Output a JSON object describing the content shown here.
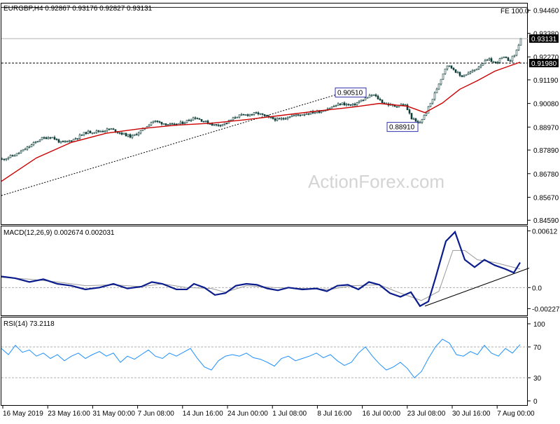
{
  "header": {
    "symbol_ohlc": "EURGBP,H4  0.92867 0.93176 0.92827 0.93131",
    "fe_label": "FE 100.0",
    "watermark": "ActionForex.com"
  },
  "colors": {
    "candles": "#0d3d38",
    "ma": "#cc0000",
    "macd": "#0b1c8c",
    "signal": "#999999",
    "rsi": "#1e90ff",
    "grid": "#b0b0b0"
  },
  "chart_data": [
    {
      "type": "candlestick",
      "panel": "price",
      "ylim": [
        0.844,
        0.9478
      ],
      "yticks": [
        "0.94460",
        "0.93380",
        "0.92270",
        "0.91190",
        "0.90080",
        "0.88970",
        "0.87890",
        "0.86780",
        "0.85670",
        "0.84590"
      ],
      "price_tags": [
        "0.93131",
        "0.91980"
      ],
      "annotations": [
        "0.90510",
        "0.88910"
      ],
      "close_path": [
        {
          "x": 0,
          "y": 0.8745
        },
        {
          "x": 20,
          "y": 0.8768
        },
        {
          "x": 40,
          "y": 0.8808
        },
        {
          "x": 55,
          "y": 0.8842
        },
        {
          "x": 70,
          "y": 0.8852
        },
        {
          "x": 85,
          "y": 0.8822
        },
        {
          "x": 100,
          "y": 0.8835
        },
        {
          "x": 120,
          "y": 0.8872
        },
        {
          "x": 140,
          "y": 0.8878
        },
        {
          "x": 155,
          "y": 0.8888
        },
        {
          "x": 170,
          "y": 0.8868
        },
        {
          "x": 185,
          "y": 0.8851
        },
        {
          "x": 200,
          "y": 0.8882
        },
        {
          "x": 215,
          "y": 0.8926
        },
        {
          "x": 230,
          "y": 0.8915
        },
        {
          "x": 245,
          "y": 0.8905
        },
        {
          "x": 260,
          "y": 0.892
        },
        {
          "x": 275,
          "y": 0.8944
        },
        {
          "x": 290,
          "y": 0.8922
        },
        {
          "x": 305,
          "y": 0.8905
        },
        {
          "x": 320,
          "y": 0.8915
        },
        {
          "x": 335,
          "y": 0.8948
        },
        {
          "x": 350,
          "y": 0.8955
        },
        {
          "x": 365,
          "y": 0.8962
        },
        {
          "x": 380,
          "y": 0.8942
        },
        {
          "x": 395,
          "y": 0.893
        },
        {
          "x": 410,
          "y": 0.8948
        },
        {
          "x": 425,
          "y": 0.8955
        },
        {
          "x": 440,
          "y": 0.8965
        },
        {
          "x": 455,
          "y": 0.8972
        },
        {
          "x": 470,
          "y": 0.899
        },
        {
          "x": 485,
          "y": 0.9008
        },
        {
          "x": 500,
          "y": 0.8998
        },
        {
          "x": 515,
          "y": 0.9025
        },
        {
          "x": 530,
          "y": 0.905
        },
        {
          "x": 545,
          "y": 0.901
        },
        {
          "x": 560,
          "y": 0.8995
        },
        {
          "x": 575,
          "y": 0.9005
        },
        {
          "x": 585,
          "y": 0.894
        },
        {
          "x": 595,
          "y": 0.891
        },
        {
          "x": 605,
          "y": 0.896
        },
        {
          "x": 615,
          "y": 0.903
        },
        {
          "x": 625,
          "y": 0.911
        },
        {
          "x": 635,
          "y": 0.919
        },
        {
          "x": 645,
          "y": 0.917
        },
        {
          "x": 655,
          "y": 0.9135
        },
        {
          "x": 665,
          "y": 0.9148
        },
        {
          "x": 675,
          "y": 0.9165
        },
        {
          "x": 685,
          "y": 0.9195
        },
        {
          "x": 695,
          "y": 0.9215
        },
        {
          "x": 705,
          "y": 0.9198
        },
        {
          "x": 715,
          "y": 0.9225
        },
        {
          "x": 725,
          "y": 0.921
        },
        {
          "x": 733,
          "y": 0.924
        },
        {
          "x": 741,
          "y": 0.9313
        }
      ],
      "ma_path": [
        {
          "x": 0,
          "y": 0.8642
        },
        {
          "x": 50,
          "y": 0.8752
        },
        {
          "x": 100,
          "y": 0.8825
        },
        {
          "x": 150,
          "y": 0.8868
        },
        {
          "x": 200,
          "y": 0.889
        },
        {
          "x": 250,
          "y": 0.8906
        },
        {
          "x": 300,
          "y": 0.8915
        },
        {
          "x": 350,
          "y": 0.8932
        },
        {
          "x": 400,
          "y": 0.8952
        },
        {
          "x": 450,
          "y": 0.8972
        },
        {
          "x": 500,
          "y": 0.899
        },
        {
          "x": 540,
          "y": 0.9008
        },
        {
          "x": 580,
          "y": 0.8995
        },
        {
          "x": 605,
          "y": 0.8965
        },
        {
          "x": 630,
          "y": 0.901
        },
        {
          "x": 655,
          "y": 0.9075
        },
        {
          "x": 680,
          "y": 0.9115
        },
        {
          "x": 705,
          "y": 0.916
        },
        {
          "x": 741,
          "y": 0.9202
        }
      ],
      "trendline_dotted": [
        {
          "x": 0,
          "y": 0.8575
        },
        {
          "x": 480,
          "y": 0.9051
        }
      ],
      "dashed_level": 0.9198,
      "solid_level": 0.9313,
      "fe_level": 0.946
    },
    {
      "type": "line",
      "panel": "macd",
      "label": "MACD(12,26,9) 0.002674 0.002031",
      "ylim": [
        -0.003,
        0.0066
      ],
      "yticks": [
        "0.00612",
        "0.0",
        "-0.002273"
      ],
      "macd": [
        {
          "x": 0,
          "y": 0.0012
        },
        {
          "x": 20,
          "y": 0.001
        },
        {
          "x": 40,
          "y": 0.0006
        },
        {
          "x": 60,
          "y": 0.0009
        },
        {
          "x": 80,
          "y": 0.0004
        },
        {
          "x": 100,
          "y": 0.0002
        },
        {
          "x": 120,
          "y": -0.0002
        },
        {
          "x": 140,
          "y": 0.0
        },
        {
          "x": 160,
          "y": 0.0004
        },
        {
          "x": 180,
          "y": -0.0001
        },
        {
          "x": 200,
          "y": 0.0001
        },
        {
          "x": 215,
          "y": 0.0006
        },
        {
          "x": 230,
          "y": 0.0004
        },
        {
          "x": 250,
          "y": -0.0002
        },
        {
          "x": 265,
          "y": -0.0002
        },
        {
          "x": 275,
          "y": 0.0004
        },
        {
          "x": 290,
          "y": 0.0
        },
        {
          "x": 305,
          "y": -0.0008
        },
        {
          "x": 320,
          "y": -0.0006
        },
        {
          "x": 335,
          "y": 0.0002
        },
        {
          "x": 350,
          "y": 0.0004
        },
        {
          "x": 365,
          "y": 0.0003
        },
        {
          "x": 380,
          "y": -0.0001
        },
        {
          "x": 395,
          "y": -0.0003
        },
        {
          "x": 410,
          "y": 0.0
        },
        {
          "x": 430,
          "y": -0.0002
        },
        {
          "x": 450,
          "y": -0.0001
        },
        {
          "x": 465,
          "y": -0.0004
        },
        {
          "x": 480,
          "y": 0.0002
        },
        {
          "x": 495,
          "y": 0.0003
        },
        {
          "x": 510,
          "y": -0.0002
        },
        {
          "x": 525,
          "y": 0.0006
        },
        {
          "x": 540,
          "y": 0.0003
        },
        {
          "x": 555,
          "y": -0.0006
        },
        {
          "x": 570,
          "y": -0.001
        },
        {
          "x": 585,
          "y": -0.0005
        },
        {
          "x": 598,
          "y": -0.002
        },
        {
          "x": 610,
          "y": -0.0015
        },
        {
          "x": 620,
          "y": 0.001
        },
        {
          "x": 635,
          "y": 0.005
        },
        {
          "x": 648,
          "y": 0.006
        },
        {
          "x": 662,
          "y": 0.003
        },
        {
          "x": 676,
          "y": 0.0022
        },
        {
          "x": 690,
          "y": 0.003
        },
        {
          "x": 705,
          "y": 0.0024
        },
        {
          "x": 720,
          "y": 0.002
        },
        {
          "x": 732,
          "y": 0.0016
        },
        {
          "x": 741,
          "y": 0.0027
        }
      ],
      "signal": [
        {
          "x": 0,
          "y": 0.0011
        },
        {
          "x": 40,
          "y": 0.0009
        },
        {
          "x": 80,
          "y": 0.0006
        },
        {
          "x": 120,
          "y": 0.0002
        },
        {
          "x": 160,
          "y": 0.0003
        },
        {
          "x": 200,
          "y": 0.0001
        },
        {
          "x": 230,
          "y": 0.0004
        },
        {
          "x": 265,
          "y": 0.0
        },
        {
          "x": 300,
          "y": -0.0001
        },
        {
          "x": 320,
          "y": -0.0005
        },
        {
          "x": 350,
          "y": 0.0002
        },
        {
          "x": 390,
          "y": 0.0
        },
        {
          "x": 430,
          "y": -0.0001
        },
        {
          "x": 470,
          "y": -0.0002
        },
        {
          "x": 500,
          "y": 0.0002
        },
        {
          "x": 540,
          "y": 0.0003
        },
        {
          "x": 570,
          "y": -0.0006
        },
        {
          "x": 600,
          "y": -0.0014
        },
        {
          "x": 625,
          "y": -0.0004
        },
        {
          "x": 645,
          "y": 0.004
        },
        {
          "x": 662,
          "y": 0.004
        },
        {
          "x": 680,
          "y": 0.003
        },
        {
          "x": 705,
          "y": 0.0027
        },
        {
          "x": 741,
          "y": 0.002
        }
      ],
      "trendline": [
        {
          "x": 605,
          "y": -0.002
        },
        {
          "x": 754,
          "y": 0.0021
        }
      ],
      "zero_line": 0.0
    },
    {
      "type": "line",
      "panel": "rsi",
      "label": "RSI(14) 73.2118",
      "ylim": [
        0,
        100
      ],
      "yticks": [
        "100",
        "70",
        "30",
        "0"
      ],
      "levels": [
        70,
        30
      ],
      "values": [
        {
          "x": 0,
          "y": 68
        },
        {
          "x": 10,
          "y": 60
        },
        {
          "x": 20,
          "y": 72
        },
        {
          "x": 30,
          "y": 63
        },
        {
          "x": 40,
          "y": 66
        },
        {
          "x": 50,
          "y": 58
        },
        {
          "x": 60,
          "y": 62
        },
        {
          "x": 70,
          "y": 55
        },
        {
          "x": 80,
          "y": 60
        },
        {
          "x": 90,
          "y": 52
        },
        {
          "x": 100,
          "y": 58
        },
        {
          "x": 110,
          "y": 62
        },
        {
          "x": 120,
          "y": 55
        },
        {
          "x": 130,
          "y": 60
        },
        {
          "x": 140,
          "y": 64
        },
        {
          "x": 150,
          "y": 58
        },
        {
          "x": 160,
          "y": 62
        },
        {
          "x": 170,
          "y": 50
        },
        {
          "x": 180,
          "y": 58
        },
        {
          "x": 190,
          "y": 54
        },
        {
          "x": 200,
          "y": 60
        },
        {
          "x": 210,
          "y": 66
        },
        {
          "x": 220,
          "y": 58
        },
        {
          "x": 230,
          "y": 55
        },
        {
          "x": 240,
          "y": 62
        },
        {
          "x": 250,
          "y": 58
        },
        {
          "x": 260,
          "y": 63
        },
        {
          "x": 270,
          "y": 68
        },
        {
          "x": 280,
          "y": 55
        },
        {
          "x": 290,
          "y": 44
        },
        {
          "x": 300,
          "y": 40
        },
        {
          "x": 310,
          "y": 52
        },
        {
          "x": 320,
          "y": 58
        },
        {
          "x": 330,
          "y": 60
        },
        {
          "x": 340,
          "y": 58
        },
        {
          "x": 350,
          "y": 62
        },
        {
          "x": 360,
          "y": 56
        },
        {
          "x": 370,
          "y": 54
        },
        {
          "x": 380,
          "y": 50
        },
        {
          "x": 390,
          "y": 45
        },
        {
          "x": 400,
          "y": 55
        },
        {
          "x": 410,
          "y": 58
        },
        {
          "x": 420,
          "y": 52
        },
        {
          "x": 430,
          "y": 55
        },
        {
          "x": 440,
          "y": 58
        },
        {
          "x": 450,
          "y": 62
        },
        {
          "x": 460,
          "y": 56
        },
        {
          "x": 470,
          "y": 60
        },
        {
          "x": 480,
          "y": 52
        },
        {
          "x": 490,
          "y": 46
        },
        {
          "x": 500,
          "y": 50
        },
        {
          "x": 510,
          "y": 62
        },
        {
          "x": 520,
          "y": 70
        },
        {
          "x": 530,
          "y": 58
        },
        {
          "x": 540,
          "y": 48
        },
        {
          "x": 550,
          "y": 40
        },
        {
          "x": 560,
          "y": 44
        },
        {
          "x": 570,
          "y": 50
        },
        {
          "x": 580,
          "y": 42
        },
        {
          "x": 590,
          "y": 30
        },
        {
          "x": 600,
          "y": 38
        },
        {
          "x": 610,
          "y": 55
        },
        {
          "x": 620,
          "y": 70
        },
        {
          "x": 630,
          "y": 80
        },
        {
          "x": 640,
          "y": 75
        },
        {
          "x": 650,
          "y": 60
        },
        {
          "x": 660,
          "y": 58
        },
        {
          "x": 670,
          "y": 64
        },
        {
          "x": 680,
          "y": 60
        },
        {
          "x": 690,
          "y": 72
        },
        {
          "x": 700,
          "y": 62
        },
        {
          "x": 710,
          "y": 58
        },
        {
          "x": 720,
          "y": 68
        },
        {
          "x": 730,
          "y": 62
        },
        {
          "x": 741,
          "y": 73
        }
      ]
    }
  ],
  "x_axis": {
    "labels": [
      "16 May 2019",
      "23 May 16:00",
      "31 May 00:00",
      "7 Jun 08:00",
      "14 Jun 16:00",
      "24 Jun 00:00",
      "1 Jul 08:00",
      "8 Jul 16:00",
      "16 Jul 00:00",
      "23 Jul 08:00",
      "30 Jul 16:00",
      "7 Aug 00:00"
    ]
  }
}
